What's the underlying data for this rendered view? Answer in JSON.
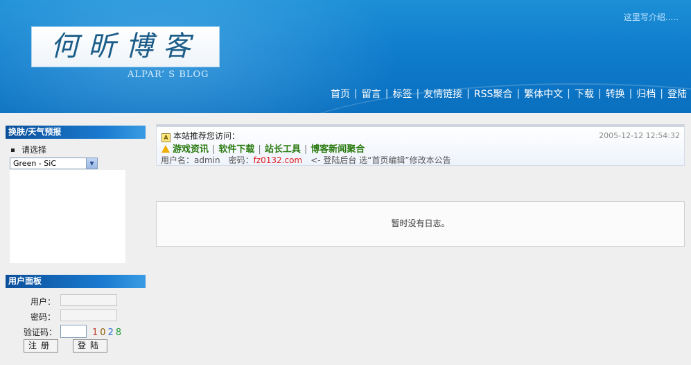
{
  "header": {
    "intro": "这里写介绍.....",
    "logo_text": "何昕博客",
    "logo_subtitle": "ALPAR’ S BLOG",
    "nav": [
      "首页",
      "留言",
      "标签",
      "友情链接",
      "RSS聚合",
      "繁体中文",
      "下载",
      "转换",
      "归档",
      "登陆"
    ]
  },
  "sidebar": {
    "skin_panel": {
      "title": "换肤/天气预报",
      "choose_label": "请选择",
      "skin_value": "Green - SiC"
    },
    "user_panel": {
      "title": "用户面板",
      "user_label": "用户：",
      "password_label": "密码：",
      "captcha_label": "验证码：",
      "captcha_code": [
        "1",
        "0",
        "2",
        "8"
      ],
      "register_button": "注册",
      "login_button": "登陆"
    }
  },
  "notice": {
    "intro": "本站推荐您访问：",
    "date": "2005-12-12 12:54:32",
    "links": [
      "游戏资讯",
      "软件下载",
      "站长工具",
      "博客新闻聚合"
    ],
    "link_separator": "|",
    "login_info_prefix": "用户名：admin　密码：",
    "login_info_site": "fz0132.com",
    "login_info_suffix": "　<- 登陆后台 选“首页编辑”修改本公告"
  },
  "main": {
    "empty_message": "暂时没有日志。"
  },
  "colors": {
    "header_blue": "#0f7ccc",
    "panel_title": "#0c4f9a",
    "link_green": "#2a7a10",
    "highlight_red": "#e02020",
    "captcha_colors": [
      "#c0392b",
      "#8a5a00",
      "#2a6fd0",
      "#1a9a30"
    ]
  },
  "icons": [
    "announcement-icon",
    "warning-icon",
    "dropdown-arrow-icon"
  ]
}
